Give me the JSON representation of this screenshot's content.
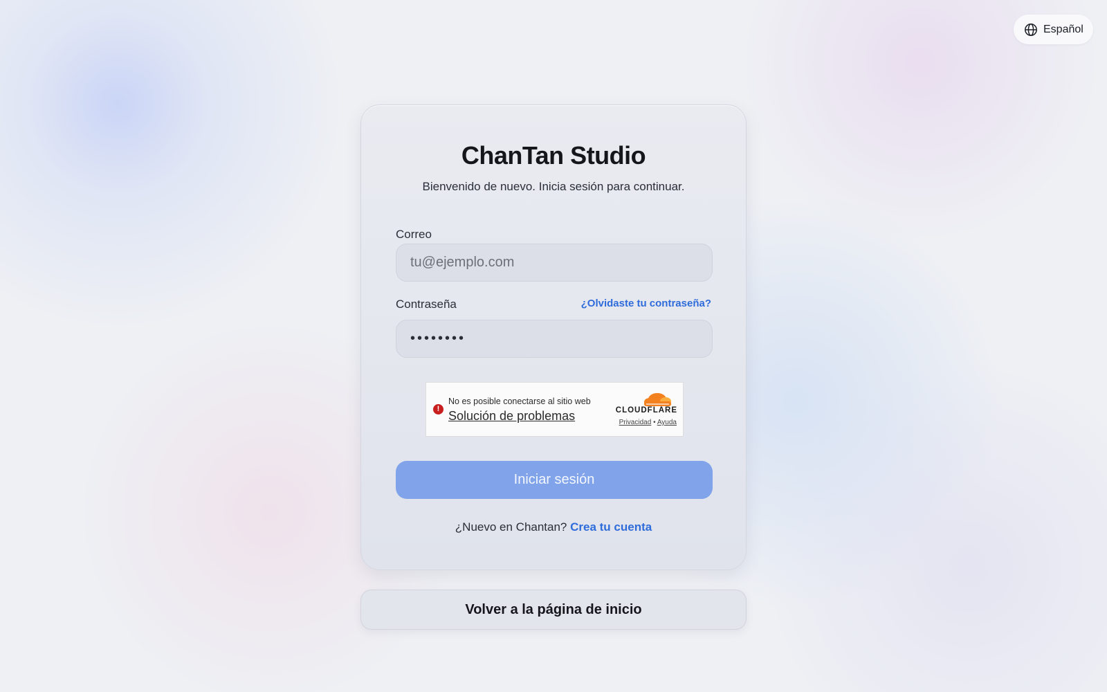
{
  "language": {
    "label": "Español"
  },
  "login": {
    "title": "ChanTan Studio",
    "subtitle": "Bienvenido de nuevo. Inicia sesión para continuar.",
    "email_label": "Correo",
    "email_placeholder": "tu@ejemplo.com",
    "email_value": "",
    "password_label": "Contraseña",
    "password_value": "••••••••",
    "forgot_link": "¿Olvidaste tu contraseña?",
    "submit_label": "Iniciar sesión",
    "signup_prompt": "¿Nuevo en Chantan?",
    "signup_link": "Crea tu cuenta"
  },
  "captcha": {
    "error_message": "No es posible conectarse al sitio web",
    "troubleshoot_link": "Solución de problemas",
    "brand": "CLOUDFLARE",
    "privacy_link": "Privacidad",
    "separator": "•",
    "help_link": "Ayuda"
  },
  "back_button": {
    "label": "Volver a la página de inicio"
  },
  "colors": {
    "accent": "#2f6cdb",
    "button_disabled": "#80a3ea",
    "error": "#c81e1e",
    "cloudflare_orange": "#f48120"
  },
  "icons": {
    "language": "globe-icon",
    "captcha_error": "exclamation-circle-icon",
    "captcha_brand": "cloudflare-cloud-icon"
  }
}
